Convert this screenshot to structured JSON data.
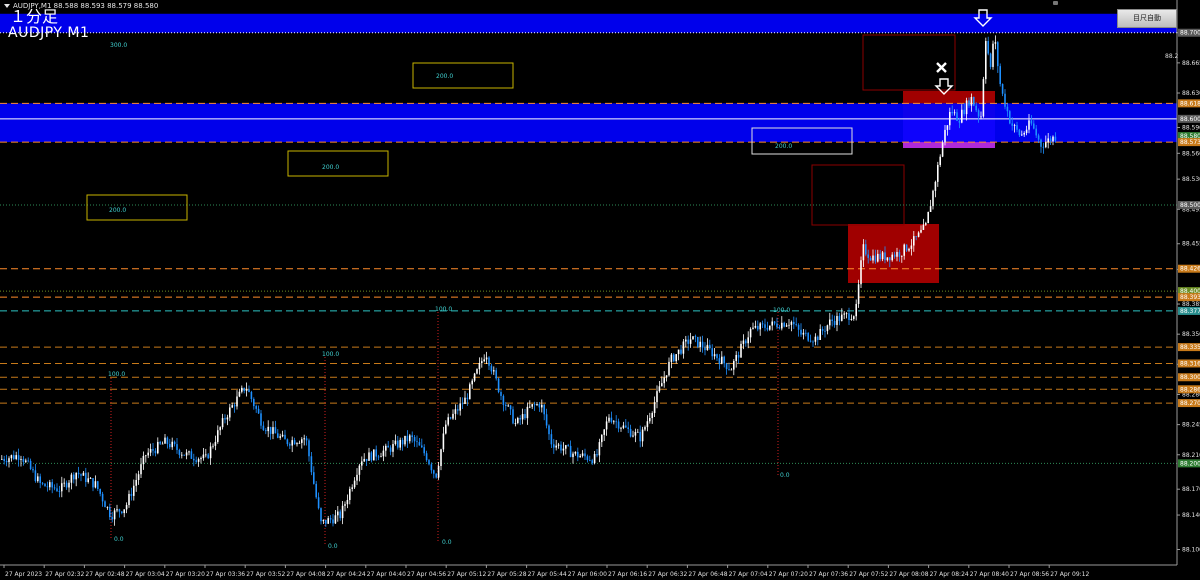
{
  "header": {
    "info": "AUDJPY,M1  88.588 88.593 88.579 88.580",
    "timeframe_jp": "１分足",
    "symbol": "AUDJPY M1"
  },
  "toolbar": {
    "auto_scale_label": "目尺自動"
  },
  "colors": {
    "background": "#000000",
    "bull_candle": "#ffffff",
    "bear_candle": "#1e90ff",
    "zone_blue": "#0000ff",
    "zone_red": "#aa0000",
    "zone_magenta": "#b030ff",
    "price_axis_text": "#e0e0e0"
  },
  "chart_data": {
    "type": "candlestick",
    "symbol": "AUDJPY",
    "timeframe": "M1",
    "ylim": [
      88.082,
      88.738
    ],
    "y_ticks": [
      88.7,
      88.665,
      88.63,
      88.59,
      88.56,
      88.53,
      88.495,
      88.455,
      88.425,
      88.385,
      88.35,
      88.315,
      88.28,
      88.245,
      88.21,
      88.17,
      88.14,
      88.1
    ],
    "x_ticks": [
      "27 Apr 2023",
      "27 Apr 02:32",
      "27 Apr 02:48",
      "27 Apr 03:04",
      "27 Apr 03:20",
      "27 Apr 03:36",
      "27 Apr 03:52",
      "27 Apr 04:08",
      "27 Apr 04:24",
      "27 Apr 04:40",
      "27 Apr 04:56",
      "27 Apr 05:12",
      "27 Apr 05:28",
      "27 Apr 05:44",
      "27 Apr 06:00",
      "27 Apr 06:16",
      "27 Apr 06:32",
      "27 Apr 06:48",
      "27 Apr 07:04",
      "27 Apr 07:20",
      "27 Apr 07:36",
      "27 Apr 07:52",
      "27 Apr 08:08",
      "27 Apr 08:24",
      "27 Apr 08:40",
      "27 Apr 08:56",
      "27 Apr 09:12"
    ],
    "price_path": [
      [
        0,
        88.205
      ],
      [
        20,
        88.21
      ],
      [
        40,
        88.175
      ],
      [
        60,
        88.17
      ],
      [
        75,
        88.19
      ],
      [
        95,
        88.175
      ],
      [
        110,
        88.14
      ],
      [
        125,
        88.15
      ],
      [
        145,
        88.21
      ],
      [
        165,
        88.225
      ],
      [
        185,
        88.21
      ],
      [
        205,
        88.205
      ],
      [
        225,
        88.255
      ],
      [
        245,
        88.29
      ],
      [
        262,
        88.245
      ],
      [
        285,
        88.225
      ],
      [
        305,
        88.23
      ],
      [
        320,
        88.13
      ],
      [
        340,
        88.14
      ],
      [
        360,
        88.205
      ],
      [
        385,
        88.215
      ],
      [
        410,
        88.23
      ],
      [
        425,
        88.21
      ],
      [
        435,
        88.185
      ],
      [
        445,
        88.245
      ],
      [
        465,
        88.275
      ],
      [
        485,
        88.33
      ],
      [
        500,
        88.28
      ],
      [
        515,
        88.245
      ],
      [
        530,
        88.265
      ],
      [
        540,
        88.27
      ],
      [
        550,
        88.225
      ],
      [
        575,
        88.21
      ],
      [
        595,
        88.205
      ],
      [
        608,
        88.255
      ],
      [
        625,
        88.24
      ],
      [
        640,
        88.23
      ],
      [
        655,
        88.275
      ],
      [
        670,
        88.32
      ],
      [
        690,
        88.345
      ],
      [
        710,
        88.33
      ],
      [
        730,
        88.31
      ],
      [
        750,
        88.355
      ],
      [
        768,
        88.36
      ],
      [
        790,
        88.365
      ],
      [
        800,
        88.35
      ],
      [
        815,
        88.345
      ],
      [
        830,
        88.365
      ],
      [
        855,
        88.375
      ],
      [
        862,
        88.45
      ],
      [
        870,
        88.44
      ],
      [
        885,
        88.44
      ],
      [
        900,
        88.445
      ],
      [
        915,
        88.46
      ],
      [
        925,
        88.475
      ],
      [
        933,
        88.52
      ],
      [
        943,
        88.58
      ],
      [
        950,
        88.61
      ],
      [
        958,
        88.6
      ],
      [
        970,
        88.625
      ],
      [
        980,
        88.6
      ],
      [
        985,
        88.695
      ],
      [
        990,
        88.655
      ],
      [
        993,
        88.7
      ],
      [
        1000,
        88.635
      ],
      [
        1010,
        88.595
      ],
      [
        1020,
        88.58
      ],
      [
        1030,
        88.595
      ],
      [
        1040,
        88.57
      ],
      [
        1055,
        88.58
      ]
    ],
    "price_labels": [
      {
        "label": "88.700",
        "value": 88.7,
        "color": "#5a5a5a"
      },
      {
        "label": "88.618",
        "value": 88.618,
        "color": "#c87a1a"
      },
      {
        "label": "88.600",
        "value": 88.6,
        "color": "#5a5a5a"
      },
      {
        "label": "88.580",
        "value": 88.58,
        "color": "#2e7d32"
      },
      {
        "label": "88.573",
        "value": 88.573,
        "color": "#c87a1a"
      },
      {
        "label": "88.500",
        "value": 88.5,
        "color": "#5a5a5a"
      },
      {
        "label": "88.426",
        "value": 88.426,
        "color": "#c87a1a"
      },
      {
        "label": "88.400",
        "value": 88.4,
        "color": "#6b8e23"
      },
      {
        "label": "88.393",
        "value": 88.393,
        "color": "#c87a1a"
      },
      {
        "label": "88.377",
        "value": 88.377,
        "color": "#2a8f8f"
      },
      {
        "label": "88.335",
        "value": 88.335,
        "color": "#c87a1a"
      },
      {
        "label": "88.316",
        "value": 88.316,
        "color": "#c87a1a"
      },
      {
        "label": "88.300",
        "value": 88.3,
        "color": "#c87a1a"
      },
      {
        "label": "88.286",
        "value": 88.286,
        "color": "#c87a1a"
      },
      {
        "label": "88.270",
        "value": 88.27,
        "color": "#c87a1a"
      },
      {
        "label": "88.200",
        "value": 88.2,
        "color": "#2e7d32"
      }
    ],
    "level_lines": [
      {
        "value": 88.7,
        "color": "#ffffff",
        "style": "dotted"
      },
      {
        "value": 88.618,
        "color": "#ff8c2a",
        "style": "dashed"
      },
      {
        "value": 88.6,
        "color": "#ffffff",
        "style": "solid"
      },
      {
        "value": 88.573,
        "color": "#ff8c2a",
        "style": "dashed"
      },
      {
        "value": 88.5,
        "color": "#2e8b57",
        "style": "dotted"
      },
      {
        "value": 88.426,
        "color": "#ff8c2a",
        "style": "dashed"
      },
      {
        "value": 88.4,
        "color": "#6b8e23",
        "style": "dotted"
      },
      {
        "value": 88.393,
        "color": "#ff8c2a",
        "style": "dashed"
      },
      {
        "value": 88.377,
        "color": "#2ec4c4",
        "style": "dashed"
      },
      {
        "value": 88.335,
        "color": "#c87a1a",
        "style": "dashed"
      },
      {
        "value": 88.316,
        "color": "#c87a1a",
        "style": "dashed"
      },
      {
        "value": 88.3,
        "color": "#c87a1a",
        "style": "dashed"
      },
      {
        "value": 88.286,
        "color": "#c87a1a",
        "style": "dashed"
      },
      {
        "value": 88.27,
        "color": "#c87a1a",
        "style": "dashed"
      },
      {
        "value": 88.2,
        "color": "#2e8b57",
        "style": "dotted"
      }
    ],
    "zones": [
      {
        "name": "upper-blue-zone",
        "y_from": 88.7,
        "y_to": 88.722,
        "color": "#0000ff"
      },
      {
        "name": "middle-blue-zone",
        "y_from": 88.573,
        "y_to": 88.618,
        "color": "#0000ff"
      }
    ],
    "annotations": {
      "yellow_boxes": [
        "200.0",
        "200.0",
        "200.0"
      ],
      "white_box": "200.0",
      "top_blue_label": "300.0",
      "vertical_top_labels": [
        "100.0",
        "100.0",
        "100.0",
        "100.0"
      ],
      "vertical_bottom_labels": [
        "0.0",
        "0.0",
        "0.0",
        "0.0"
      ]
    }
  }
}
